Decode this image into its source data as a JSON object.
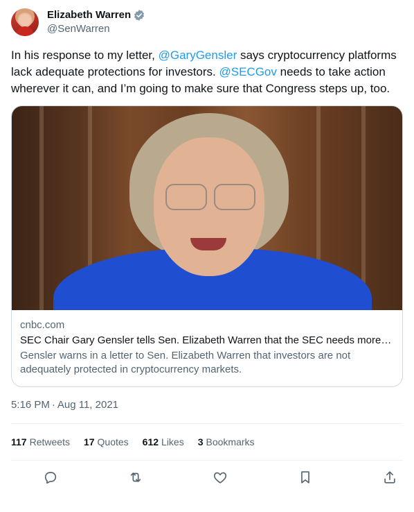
{
  "author": {
    "display_name": "Elizabeth Warren",
    "handle": "@SenWarren",
    "verified": true
  },
  "tweet": {
    "text_parts": {
      "p1": "In his response to my letter, ",
      "mention1": "@GaryGensler",
      "p2": " says cryptocurrency platforms lack adequate protections for investors. ",
      "mention2": "@SECGov",
      "p3": " needs to take action wherever it can, and I’m going to make sure that Congress steps up, too."
    },
    "timestamp_time": "5:16 PM",
    "timestamp_sep": "·",
    "timestamp_date": "Aug 11, 2021"
  },
  "card": {
    "domain": "cnbc.com",
    "title": "SEC Chair Gary Gensler tells Sen. Elizabeth Warren that the SEC needs more r...",
    "description": "Gensler warns in a letter to Sen. Elizabeth Warren that investors are not adequately protected in cryptocurrency markets."
  },
  "stats": {
    "retweets": {
      "count": "117",
      "label": "Retweets"
    },
    "quotes": {
      "count": "17",
      "label": "Quotes"
    },
    "likes": {
      "count": "612",
      "label": "Likes"
    },
    "bookmarks": {
      "count": "3",
      "label": "Bookmarks"
    }
  },
  "actions": [
    "reply-icon",
    "retweet-icon",
    "like-icon",
    "bookmark-icon",
    "share-icon"
  ],
  "colors": {
    "link": "#1d9bf0",
    "secondary_text": "#536471",
    "verified_badge": "#829aab"
  }
}
